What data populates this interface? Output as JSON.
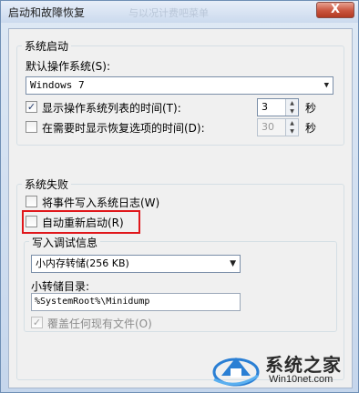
{
  "window": {
    "title": "启动和故障恢复",
    "ghost_title": "与以况计费吧菜单",
    "close_glyph": "X"
  },
  "startup": {
    "group_label": "系统启动",
    "default_os_label": "默认操作系统(S):",
    "default_os_value": "Windows 7",
    "show_os_list": {
      "label": "显示操作系统列表的时间(T):",
      "checked": true,
      "value": "3",
      "unit": "秒"
    },
    "show_recovery": {
      "label": "在需要时显示恢复选项的时间(D):",
      "checked": false,
      "value": "30",
      "unit": "秒"
    }
  },
  "failure": {
    "group_label": "系统失败",
    "write_event": {
      "label": "将事件写入系统日志(W)",
      "checked": false
    },
    "auto_restart": {
      "label": "自动重新启动(R)",
      "checked": false
    },
    "debug_group_label": "写入调试信息",
    "debug_type_value": "小内存转储(256 KB)",
    "dump_dir_label": "小转储目录:",
    "dump_dir_value": "%SystemRoot%\\Minidump",
    "overwrite": {
      "label": "覆盖任何现有文件(O)",
      "checked": true,
      "disabled": true
    }
  },
  "watermark": {
    "text": "系统之家",
    "url": "Win10net.com"
  },
  "colors": {
    "highlight": "#e0171b",
    "title_bg": "#dfe9f5",
    "client_bg": "#f0f0f0"
  }
}
